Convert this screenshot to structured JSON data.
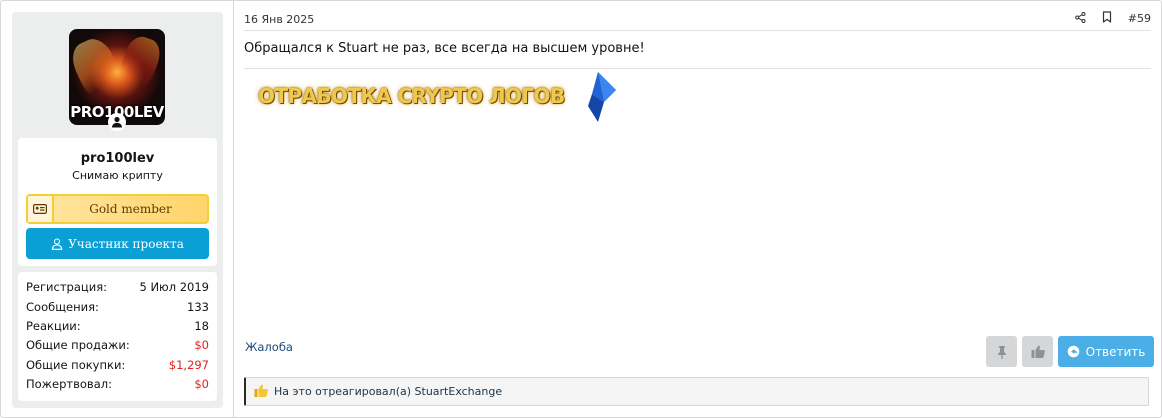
{
  "user": {
    "avatar_text": "PRO100LEV",
    "name": "pro100lev",
    "title": "Снимаю крипту",
    "banner": "Gold member",
    "project_button": "Участник проекта",
    "stats": [
      {
        "label": "Регистрация:",
        "value": "5 Июл 2019"
      },
      {
        "label": "Сообщения:",
        "value": "133"
      },
      {
        "label": "Реакции:",
        "value": "18"
      },
      {
        "label": "Общие продажи:",
        "value": "$0",
        "highlight": true
      },
      {
        "label": "Общие покупки:",
        "value": "$1,297",
        "highlight": true
      },
      {
        "label": "Пожертвовал:",
        "value": "$0",
        "highlight": true
      }
    ]
  },
  "post": {
    "date": "16 Янв 2025",
    "number": "#59",
    "message": "Обращался к Stuart не раз, все всегда на высшем уровне!",
    "image_text": "ОТРАБОТКА CRYPTO ЛОГОВ",
    "report": "Жалоба",
    "reply": "Ответить",
    "reactions": "На это отреагировал(а) StuartExchange"
  },
  "colors": {
    "accent": "#0aa0d6",
    "reply": "#4caee6",
    "gold_border": "#f3cf35",
    "money": "#e02020"
  },
  "icons": [
    "user-icon",
    "id-card-icon",
    "share-icon",
    "bookmark-icon",
    "pin-icon",
    "thumbs-up-icon",
    "reply-icon",
    "thumbs-up-reaction-icon",
    "crystal-icon"
  ]
}
